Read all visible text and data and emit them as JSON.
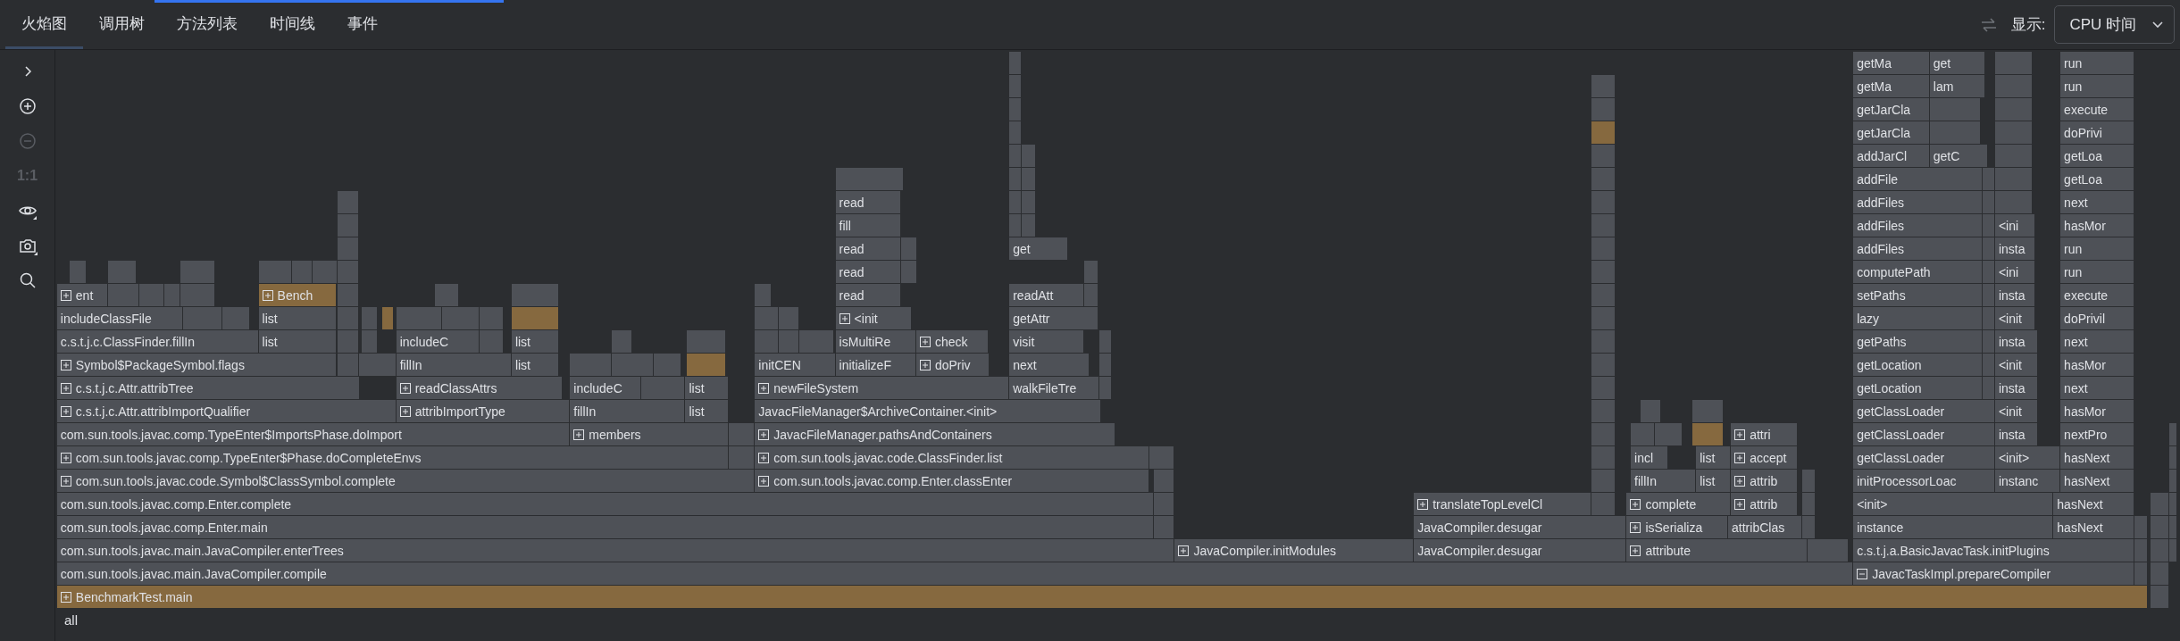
{
  "tabs": [
    {
      "label": "火焰图",
      "selected": true
    },
    {
      "label": "调用树",
      "selected": false
    },
    {
      "label": "方法列表",
      "selected": false
    },
    {
      "label": "时间线",
      "selected": false
    },
    {
      "label": "事件",
      "selected": false
    }
  ],
  "display": {
    "label": "显示:",
    "value": "CPU 时间"
  },
  "toolbar": [
    {
      "kind": "expand",
      "disabled": false
    },
    {
      "kind": "zoom_in",
      "disabled": false
    },
    {
      "kind": "zoom_out",
      "disabled": true
    },
    {
      "kind": "actual_size",
      "label": "1:1",
      "disabled": true
    },
    {
      "kind": "view",
      "disabled": false
    },
    {
      "kind": "screenshot",
      "disabled": false
    },
    {
      "kind": "search",
      "disabled": false
    }
  ],
  "flame": {
    "rows": [
      {
        "frames": [
          {
            "label": "getMa",
            "kind": "plain",
            "highlighted": false
          },
          {
            "label": "get",
            "kind": "plain",
            "highlighted": false
          },
          {
            "label": "run",
            "kind": "plain",
            "highlighted": false
          }
        ]
      },
      {
        "frames": [
          {
            "label": "getMa",
            "kind": "plain",
            "highlighted": false
          },
          {
            "label": "lam",
            "kind": "plain",
            "highlighted": false
          },
          {
            "label": "run",
            "kind": "plain",
            "highlighted": false
          }
        ]
      },
      {
        "frames": [
          {
            "label": "getJarCla",
            "kind": "plain",
            "highlighted": false
          },
          {
            "label": "execute",
            "kind": "plain",
            "highlighted": false
          }
        ]
      },
      {
        "frames": [
          {
            "label": "getJarCla",
            "kind": "plain",
            "highlighted": false
          },
          {
            "label": "doPrivi",
            "kind": "plain",
            "highlighted": false
          }
        ]
      },
      {
        "frames": [
          {
            "label": "addJarCl",
            "kind": "plain",
            "highlighted": false
          },
          {
            "label": "getC",
            "kind": "plain",
            "highlighted": false
          },
          {
            "label": "getLoa",
            "kind": "plain",
            "highlighted": false
          }
        ]
      },
      {
        "frames": [
          {
            "label": "addFile",
            "kind": "plain",
            "highlighted": false
          },
          {
            "label": "getLoa",
            "kind": "plain",
            "highlighted": false
          }
        ]
      },
      {
        "frames": [
          {
            "label": "read",
            "kind": "plain",
            "highlighted": false
          },
          {
            "label": "addFiles",
            "kind": "plain",
            "highlighted": false
          },
          {
            "label": "next",
            "kind": "plain",
            "highlighted": false
          }
        ]
      },
      {
        "frames": [
          {
            "label": "fill",
            "kind": "plain",
            "highlighted": false
          },
          {
            "label": "addFiles",
            "kind": "plain",
            "highlighted": false
          },
          {
            "label": "<ini",
            "kind": "plain",
            "highlighted": false
          },
          {
            "label": "hasMor",
            "kind": "plain",
            "highlighted": false
          }
        ]
      },
      {
        "frames": [
          {
            "label": "read",
            "kind": "plain",
            "highlighted": false
          },
          {
            "label": "get",
            "kind": "plain",
            "highlighted": false
          },
          {
            "label": "addFiles",
            "kind": "plain",
            "highlighted": false
          },
          {
            "label": "insta",
            "kind": "plain",
            "highlighted": false
          },
          {
            "label": "run",
            "kind": "plain",
            "highlighted": false
          }
        ]
      },
      {
        "frames": [
          {
            "label": "read",
            "kind": "plain",
            "highlighted": false
          },
          {
            "label": "computePath",
            "kind": "plain",
            "highlighted": false
          },
          {
            "label": "<ini",
            "kind": "plain",
            "highlighted": false
          },
          {
            "label": "run",
            "kind": "plain",
            "highlighted": false
          }
        ]
      },
      {
        "frames": [
          {
            "label": "ent",
            "kind": "expandable",
            "highlighted": false
          },
          {
            "label": "Bench",
            "kind": "expandable",
            "highlighted": true
          },
          {
            "label": "read",
            "kind": "plain",
            "highlighted": false
          },
          {
            "label": "readAtt",
            "kind": "plain",
            "highlighted": false
          },
          {
            "label": "setPaths",
            "kind": "plain",
            "highlighted": false
          },
          {
            "label": "insta",
            "kind": "plain",
            "highlighted": false
          },
          {
            "label": "execute",
            "kind": "plain",
            "highlighted": false
          }
        ]
      },
      {
        "frames": [
          {
            "label": "includeClassFile",
            "kind": "plain",
            "highlighted": false
          },
          {
            "label": "list",
            "kind": "plain",
            "highlighted": false
          },
          {
            "label": "<init",
            "kind": "expandable",
            "highlighted": false
          },
          {
            "label": "getAttr",
            "kind": "plain",
            "highlighted": false
          },
          {
            "label": "lazy",
            "kind": "plain",
            "highlighted": false
          },
          {
            "label": "<init",
            "kind": "plain",
            "highlighted": false
          },
          {
            "label": "doPrivil",
            "kind": "plain",
            "highlighted": false
          }
        ]
      },
      {
        "frames": [
          {
            "label": "c.s.t.j.c.ClassFinder.fillIn",
            "kind": "plain",
            "highlighted": false
          },
          {
            "label": "list",
            "kind": "plain",
            "highlighted": false
          },
          {
            "label": "includeC",
            "kind": "plain",
            "highlighted": false
          },
          {
            "label": "list",
            "kind": "plain",
            "highlighted": false
          },
          {
            "label": "isMultiRe",
            "kind": "plain",
            "highlighted": false
          },
          {
            "label": "check",
            "kind": "expandable",
            "highlighted": false
          },
          {
            "label": "visit",
            "kind": "plain",
            "highlighted": false
          },
          {
            "label": "getPaths",
            "kind": "plain",
            "highlighted": false
          },
          {
            "label": "insta",
            "kind": "plain",
            "highlighted": false
          },
          {
            "label": "next",
            "kind": "plain",
            "highlighted": false
          }
        ]
      },
      {
        "frames": [
          {
            "label": "Symbol$PackageSymbol.flags",
            "kind": "expandable",
            "highlighted": false
          },
          {
            "label": "fillIn",
            "kind": "plain",
            "highlighted": false
          },
          {
            "label": "list",
            "kind": "plain",
            "highlighted": false
          },
          {
            "label": "initCEN",
            "kind": "plain",
            "highlighted": false
          },
          {
            "label": "initializeF",
            "kind": "plain",
            "highlighted": false
          },
          {
            "label": "doPriv",
            "kind": "expandable",
            "highlighted": false
          },
          {
            "label": "next",
            "kind": "plain",
            "highlighted": false
          },
          {
            "label": "getLocation",
            "kind": "plain",
            "highlighted": false
          },
          {
            "label": "<init",
            "kind": "plain",
            "highlighted": false
          },
          {
            "label": "hasMor",
            "kind": "plain",
            "highlighted": false
          }
        ]
      },
      {
        "frames": [
          {
            "label": "c.s.t.j.c.Attr.attribTree",
            "kind": "expandable",
            "highlighted": false
          },
          {
            "label": "readClassAttrs",
            "kind": "expandable",
            "highlighted": false
          },
          {
            "label": "includeC",
            "kind": "plain",
            "highlighted": false
          },
          {
            "label": "list",
            "kind": "plain",
            "highlighted": false
          },
          {
            "label": "newFileSystem",
            "kind": "expandable",
            "highlighted": false
          },
          {
            "label": "walkFileTre",
            "kind": "plain",
            "highlighted": false
          },
          {
            "label": "getLocation",
            "kind": "plain",
            "highlighted": false
          },
          {
            "label": "insta",
            "kind": "plain",
            "highlighted": false
          },
          {
            "label": "next",
            "kind": "plain",
            "highlighted": false
          }
        ]
      },
      {
        "frames": [
          {
            "label": "c.s.t.j.c.Attr.attribImportQualifier",
            "kind": "expandable",
            "highlighted": false
          },
          {
            "label": "attribImportType",
            "kind": "expandable",
            "highlighted": false
          },
          {
            "label": "fillIn",
            "kind": "plain",
            "highlighted": false
          },
          {
            "label": "list",
            "kind": "plain",
            "highlighted": false
          },
          {
            "label": "JavacFileManager$ArchiveContainer.<init>",
            "kind": "plain",
            "highlighted": false
          },
          {
            "label": "getClassLoader",
            "kind": "plain",
            "highlighted": false
          },
          {
            "label": "<init",
            "kind": "plain",
            "highlighted": false
          },
          {
            "label": "hasMor",
            "kind": "plain",
            "highlighted": false
          }
        ]
      },
      {
        "frames": [
          {
            "label": "com.sun.tools.javac.comp.TypeEnter$ImportsPhase.doImport",
            "kind": "plain",
            "highlighted": false
          },
          {
            "label": "members",
            "kind": "expandable",
            "highlighted": false
          },
          {
            "label": "JavacFileManager.pathsAndContainers",
            "kind": "expandable",
            "highlighted": false
          },
          {
            "label": "attri",
            "kind": "expandable",
            "highlighted": false
          },
          {
            "label": "getClassLoader",
            "kind": "plain",
            "highlighted": false
          },
          {
            "label": "insta",
            "kind": "plain",
            "highlighted": false
          },
          {
            "label": "nextPro",
            "kind": "plain",
            "highlighted": false
          }
        ]
      },
      {
        "frames": [
          {
            "label": "com.sun.tools.javac.comp.TypeEnter$Phase.doCompleteEnvs",
            "kind": "expandable",
            "highlighted": false
          },
          {
            "label": "com.sun.tools.javac.code.ClassFinder.list",
            "kind": "expandable",
            "highlighted": false
          },
          {
            "label": "incl",
            "kind": "plain",
            "highlighted": false
          },
          {
            "label": "list",
            "kind": "plain",
            "highlighted": false
          },
          {
            "label": "accept",
            "kind": "expandable",
            "highlighted": false
          },
          {
            "label": "getClassLoader",
            "kind": "plain",
            "highlighted": false
          },
          {
            "label": "<init>",
            "kind": "plain",
            "highlighted": false
          },
          {
            "label": "hasNext",
            "kind": "plain",
            "highlighted": false
          }
        ]
      },
      {
        "frames": [
          {
            "label": "com.sun.tools.javac.code.Symbol$ClassSymbol.complete",
            "kind": "expandable",
            "highlighted": false
          },
          {
            "label": "com.sun.tools.javac.comp.Enter.classEnter",
            "kind": "expandable",
            "highlighted": false
          },
          {
            "label": "fillIn",
            "kind": "plain",
            "highlighted": false
          },
          {
            "label": "list",
            "kind": "plain",
            "highlighted": false
          },
          {
            "label": "attrib",
            "kind": "expandable",
            "highlighted": false
          },
          {
            "label": "initProcessorLoac",
            "kind": "plain",
            "highlighted": false
          },
          {
            "label": "instanc",
            "kind": "plain",
            "highlighted": false
          },
          {
            "label": "hasNext",
            "kind": "plain",
            "highlighted": false
          }
        ]
      },
      {
        "frames": [
          {
            "label": "com.sun.tools.javac.comp.Enter.complete",
            "kind": "plain",
            "highlighted": false
          },
          {
            "label": "translateTopLevelCl",
            "kind": "expandable",
            "highlighted": false
          },
          {
            "label": "complete",
            "kind": "expandable",
            "highlighted": false
          },
          {
            "label": "attrib",
            "kind": "expandable",
            "highlighted": false
          },
          {
            "label": "<init>",
            "kind": "plain",
            "highlighted": false
          },
          {
            "label": "hasNext",
            "kind": "plain",
            "highlighted": false
          }
        ]
      },
      {
        "frames": [
          {
            "label": "com.sun.tools.javac.comp.Enter.main",
            "kind": "plain",
            "highlighted": false
          },
          {
            "label": "JavaCompiler.desugar",
            "kind": "plain",
            "highlighted": false
          },
          {
            "label": "isSerializa",
            "kind": "expandable",
            "highlighted": false
          },
          {
            "label": "attribClas",
            "kind": "plain",
            "highlighted": false
          },
          {
            "label": "instance",
            "kind": "plain",
            "highlighted": false
          },
          {
            "label": "hasNext",
            "kind": "plain",
            "highlighted": false
          }
        ]
      },
      {
        "frames": [
          {
            "label": "com.sun.tools.javac.main.JavaCompiler.enterTrees",
            "kind": "plain",
            "highlighted": false
          },
          {
            "label": "JavaCompiler.initModules",
            "kind": "expandable",
            "highlighted": false
          },
          {
            "label": "JavaCompiler.desugar",
            "kind": "plain",
            "highlighted": false
          },
          {
            "label": "attribute",
            "kind": "expandable",
            "highlighted": false
          },
          {
            "label": "c.s.t.j.a.BasicJavacTask.initPlugins",
            "kind": "plain",
            "highlighted": false
          }
        ]
      },
      {
        "frames": [
          {
            "label": "com.sun.tools.javac.main.JavaCompiler.compile",
            "kind": "plain",
            "highlighted": false
          },
          {
            "label": "JavacTaskImpl.prepareCompiler",
            "kind": "expanded",
            "highlighted": false
          }
        ]
      },
      {
        "frames": [
          {
            "label": "BenchmarkTest.main",
            "kind": "expandable",
            "highlighted": true
          }
        ]
      }
    ],
    "root": "all"
  }
}
